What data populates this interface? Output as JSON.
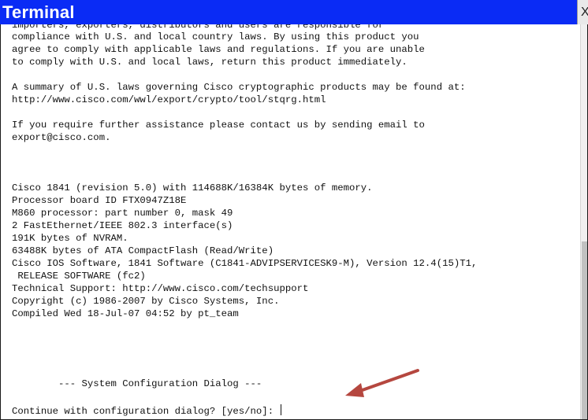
{
  "window": {
    "title": "Terminal",
    "close_label": "X",
    "title_bar_color": "#0a2bf5"
  },
  "terminal": {
    "lines": [
      "importers, exporters, distributors and users are responsible for",
      "compliance with U.S. and local country laws. By using this product you",
      "agree to comply with applicable laws and regulations. If you are unable",
      "to comply with U.S. and local laws, return this product immediately.",
      "",
      "A summary of U.S. laws governing Cisco cryptographic products may be found at:",
      "http://www.cisco.com/wwl/export/crypto/tool/stqrg.html",
      "",
      "If you require further assistance please contact us by sending email to",
      "export@cisco.com.",
      "",
      "",
      "",
      "Cisco 1841 (revision 5.0) with 114688K/16384K bytes of memory.",
      "Processor board ID FTX0947Z18E",
      "M860 processor: part number 0, mask 49",
      "2 FastEthernet/IEEE 802.3 interface(s)",
      "191K bytes of NVRAM.",
      "63488K bytes of ATA CompactFlash (Read/Write)",
      "Cisco IOS Software, 1841 Software (C1841-ADVIPSERVICESK9-M), Version 12.4(15)T1,",
      " RELEASE SOFTWARE (fc2)",
      "Technical Support: http://www.cisco.com/techsupport",
      "Copyright (c) 1986-2007 by Cisco Systems, Inc.",
      "Compiled Wed 18-Jul-07 04:52 by pt_team",
      "",
      "",
      "",
      "        --- System Configuration Dialog ---",
      "",
      "Continue with configuration dialog? [yes/no]: "
    ]
  },
  "annotation": {
    "arrow_color": "#b5473f",
    "icon": "arrow-pointing-at-prompt"
  }
}
